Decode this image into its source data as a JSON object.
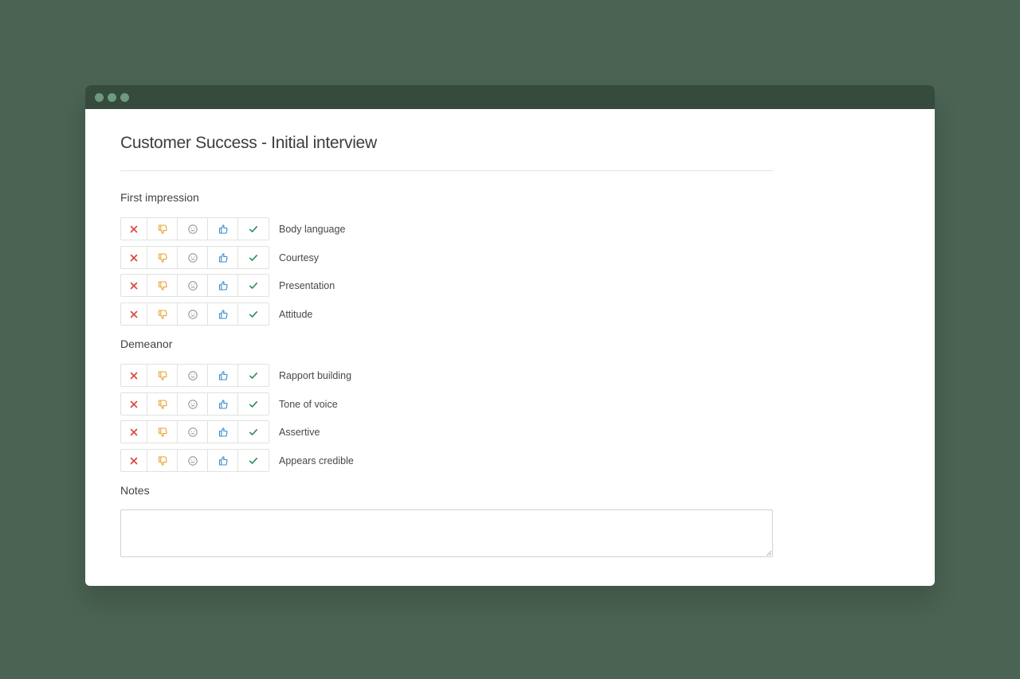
{
  "page": {
    "title": "Customer Success - Initial interview"
  },
  "rating_icons": [
    "cross-icon",
    "thumbs-down-icon",
    "neutral-face-icon",
    "thumbs-up-icon",
    "checkmark-icon"
  ],
  "colors": {
    "background": "#4a6353",
    "titlebar": "#364a3d",
    "cross": "#d9453a",
    "thumbs_down": "#eaa22c",
    "neutral": "#8a8f8b",
    "thumbs_up": "#3d8ccc",
    "check": "#2e8a52"
  },
  "sections": [
    {
      "heading": "First impression",
      "items": [
        "Body language",
        "Courtesy",
        "Presentation",
        "Attitude"
      ]
    },
    {
      "heading": "Demeanor",
      "items": [
        "Rapport building",
        "Tone of voice",
        "Assertive",
        "Appears credible"
      ]
    }
  ],
  "notes": {
    "heading": "Notes",
    "value": "",
    "placeholder": ""
  }
}
